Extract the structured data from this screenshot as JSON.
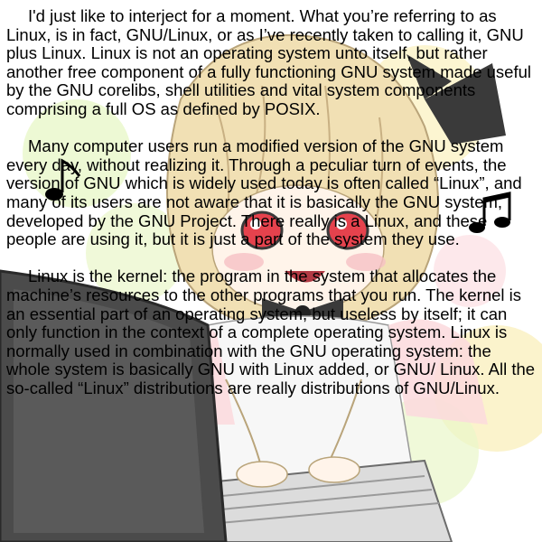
{
  "copypasta": {
    "paragraphs": [
      "I'd just like to interject for a moment. What you’re referring to as Linux, is in fact, GNU/Linux, or as I’ve recently taken to calling it, GNU plus Linux. Linux is not an operating system unto itself, but rather another free component of a fully functioning GNU system made useful by the GNU corelibs, shell utilities and vital system components comprising a full OS as defined by POSIX.",
      "Many computer users run a modified version of the GNU system every day, without realizing it. Through a peculiar turn of events, the version of GNU which is widely used today is often called “Linux”, and many of its users are not aware that it is basically the GNU system, developed by the GNU Project. There really is a Linux, and these people are using it, but it is just a part of the system they use.",
      "Linux is the kernel: the program in the system that allocates the machine’s resources to the other programs that you run. The kernel is an essential part of an operating system, but useless by itself; it can only function in the context of a complete operating system. Linux is normally used in combination with the GNU operating system: the whole system is basically GNU with Linux added, or GNU/ Linux. All the so-called “Linux” distributions are really distributions of GNU/Linux."
    ]
  },
  "illustration": {
    "icons": [
      "music-note-icon",
      "double-music-note-icon"
    ],
    "colors": {
      "background": "#ffffff",
      "hair": "#f1e0b4",
      "bow": "#3a3a3a",
      "eyes": "#e5424d",
      "monitor": "#4b4b4b",
      "keyboard": "#dcdcdc",
      "highlight_green": "#e9f7c9",
      "highlight_yellow": "#fbf2c6",
      "highlight_pink": "#fbd9dd"
    }
  }
}
